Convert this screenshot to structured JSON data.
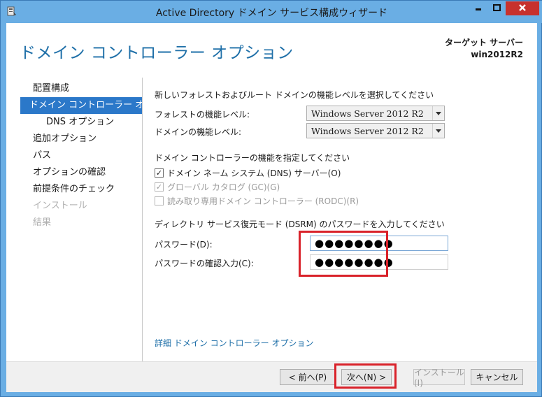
{
  "window": {
    "title": "Active Directory ドメイン サービス構成ウィザード",
    "title_bar_color": "#6aaee4",
    "close_color": "#c7312d"
  },
  "header": {
    "page_title": "ドメイン コントローラー オプション",
    "target_label": "ターゲット サーバー",
    "target_server": "win2012R2"
  },
  "nav": {
    "items": [
      {
        "label": "配置構成",
        "state": "normal"
      },
      {
        "label": "ドメイン コントローラー オプ...",
        "state": "selected"
      },
      {
        "label": "DNS オプション",
        "state": "sub"
      },
      {
        "label": "追加オプション",
        "state": "normal"
      },
      {
        "label": "パス",
        "state": "normal"
      },
      {
        "label": "オプションの確認",
        "state": "normal"
      },
      {
        "label": "前提条件のチェック",
        "state": "normal"
      },
      {
        "label": "インストール",
        "state": "disabled"
      },
      {
        "label": "結果",
        "state": "disabled"
      }
    ]
  },
  "functional_levels": {
    "heading": "新しいフォレストおよびルート ドメインの機能レベルを選択してください",
    "forest_label": "フォレストの機能レベル:",
    "forest_value": "Windows Server 2012 R2",
    "domain_label": "ドメインの機能レベル:",
    "domain_value": "Windows Server 2012 R2"
  },
  "capabilities": {
    "heading": "ドメイン コントローラーの機能を指定してください",
    "dns": {
      "label": "ドメイン ネーム システム (DNS) サーバー(O)",
      "checked": true,
      "enabled": true
    },
    "gc": {
      "label": "グローバル カタログ (GC)(G)",
      "checked": true,
      "enabled": false
    },
    "rodc": {
      "label": "読み取り専用ドメイン コントローラー (RODC)(R)",
      "checked": false,
      "enabled": false
    }
  },
  "dsrm": {
    "heading": "ディレクトリ サービス復元モード (DSRM) のパスワードを入力してください",
    "password_label": "パスワード(D):",
    "password_value": "●●●●●●●●",
    "confirm_label": "パスワードの確認入力(C):",
    "confirm_value": "●●●●●●●●"
  },
  "more_options_link": "詳細 ドメイン コントローラー オプション",
  "footer": {
    "prev": "< 前へ(P)",
    "next": "次へ(N) >",
    "install": "インストール(I)",
    "cancel": "キャンセル"
  },
  "accent_color": "#2b78c9",
  "highlight_color": "#d9222a",
  "icons": {
    "app": "server-wizard-icon",
    "minimize": "minimize-icon",
    "maximize": "maximize-icon",
    "close": "close-icon",
    "dropdown": "chevron-down-icon"
  }
}
